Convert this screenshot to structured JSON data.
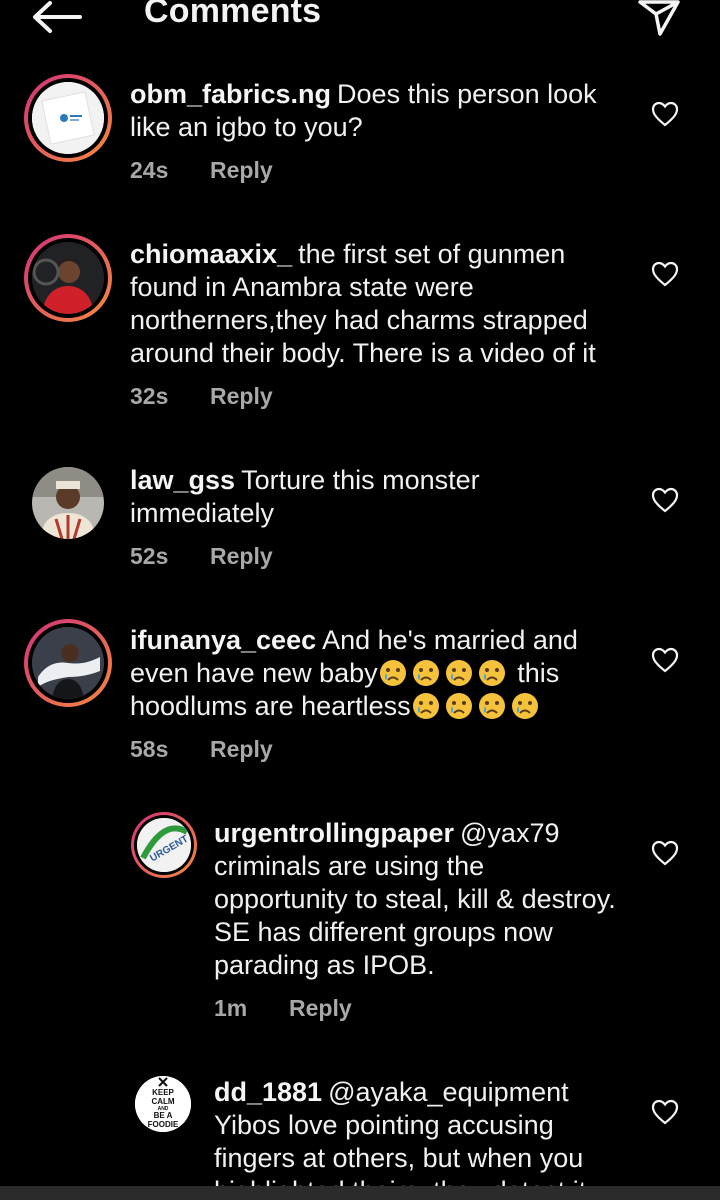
{
  "header": {
    "title": "Comments"
  },
  "reply_label": "Reply",
  "comments": [
    {
      "username": "obm_fabrics.ng",
      "text": "Does this person look like an igbo to you?",
      "time": "24s",
      "avatar": "brand-logo-avatar",
      "story_ring": true
    },
    {
      "username": "chiomaaxix_",
      "text": "the first set of gunmen found in Anambra state were northerners,they had charms strapped around their body. There is a video of it",
      "time": "32s",
      "avatar": "woman-red-top-avatar",
      "story_ring": true
    },
    {
      "username": "law_gss",
      "text": "Torture this monster immediately",
      "time": "52s",
      "avatar": "man-portrait-avatar",
      "story_ring": false
    },
    {
      "username": "ifunanya_ceec",
      "text": "And he's married and even have new baby",
      "text2": "this hoodlums are heartless",
      "time": "58s",
      "avatar": "woman-white-top-avatar",
      "story_ring": true,
      "emoji": "crying-face"
    },
    {
      "username": "urgentrollingpaper",
      "mention": "@yax79",
      "text": "criminals are using the opportunity to steal, kill & destroy. SE has different groups now parading as IPOB.",
      "time": "1m",
      "avatar": "urgent-logo-avatar",
      "story_ring": true
    },
    {
      "username": "dd_1881",
      "mention": "@ayaka_equipment",
      "text": "Yibos love pointing accusing fingers at others, but when you highlighted theirs, they detect it",
      "avatar": "keep-calm-avatar",
      "avatar_text": [
        "KEEP",
        "CALM",
        "AND",
        "BE A",
        "FOODIE"
      ],
      "story_ring": false
    }
  ],
  "colors": {
    "background": "#000000",
    "text": "#f1f1f1",
    "meta": "#a8a8a8",
    "ring_start": "#d3307b",
    "ring_end": "#f58b3b"
  }
}
